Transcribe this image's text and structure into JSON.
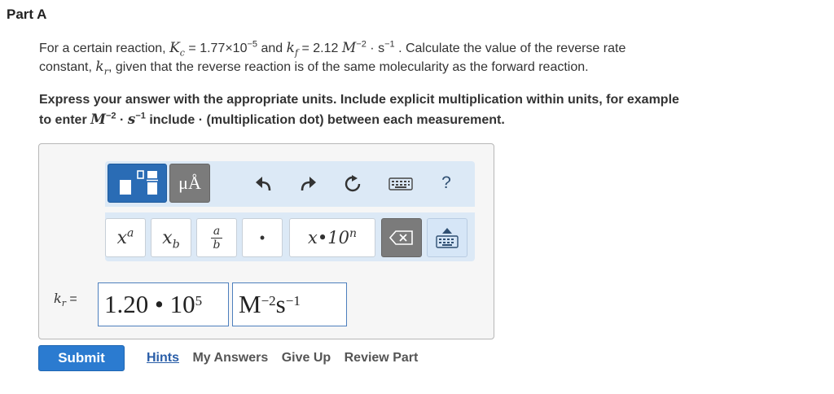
{
  "part": {
    "title": "Part A"
  },
  "question": {
    "intro": "For a certain reaction,",
    "kc_symbol": "K",
    "kc_sub": "c",
    "kc_eq": "= 1.77×10",
    "kc_exp": "−5",
    "and": "and",
    "kf_symbol": "k",
    "kf_sub": "f",
    "kf_eq": "= 2.12",
    "unit_M": "M",
    "unit_M_exp": "−2",
    "unit_dot": "·",
    "unit_s": "s",
    "unit_s_exp": "−1",
    "rest1": ". Calculate the value of the reverse rate",
    "rest2a": "constant,",
    "kr_symbol": "k",
    "kr_sub": "r",
    "rest2b": ", given that the reverse reaction is of the same molecularity as the forward reaction."
  },
  "instructions": {
    "line1": "Express your answer with the appropriate units. Include explicit multiplication within units, for example",
    "line2a": "to enter",
    "ex_M": "M",
    "ex_M_exp": "−2",
    "ex_dot": "·",
    "ex_s": "s",
    "ex_s_exp": "−1",
    "line2b": "include · (multiplication dot) between each measurement."
  },
  "toolbar": {
    "mu_label": "μÅ",
    "help_label": "?",
    "power_base": "x",
    "power_exp": "a",
    "sub_base": "x",
    "sub_sub": "b",
    "frac_num": "a",
    "frac_den": "b",
    "dot_label": "•",
    "sci_label": "x•10",
    "sci_exp": "n"
  },
  "answer": {
    "label_symbol": "k",
    "label_sub": "r",
    "label_eq": "=",
    "value_mantissa": "1.20 • 10",
    "value_exp": "5",
    "unit_M": "M",
    "unit_M_exp": "−2",
    "unit_s": "s",
    "unit_s_exp": "−1"
  },
  "actions": {
    "submit": "Submit",
    "hints": "Hints",
    "my_answers": "My Answers",
    "give_up": "Give Up",
    "review_part": "Review Part"
  },
  "colors": {
    "toolbar_bg": "#dce9f6",
    "submit_bg": "#2b7bd0",
    "field_border": "#4d7fbd",
    "template_btn": "#2a6cb5"
  }
}
